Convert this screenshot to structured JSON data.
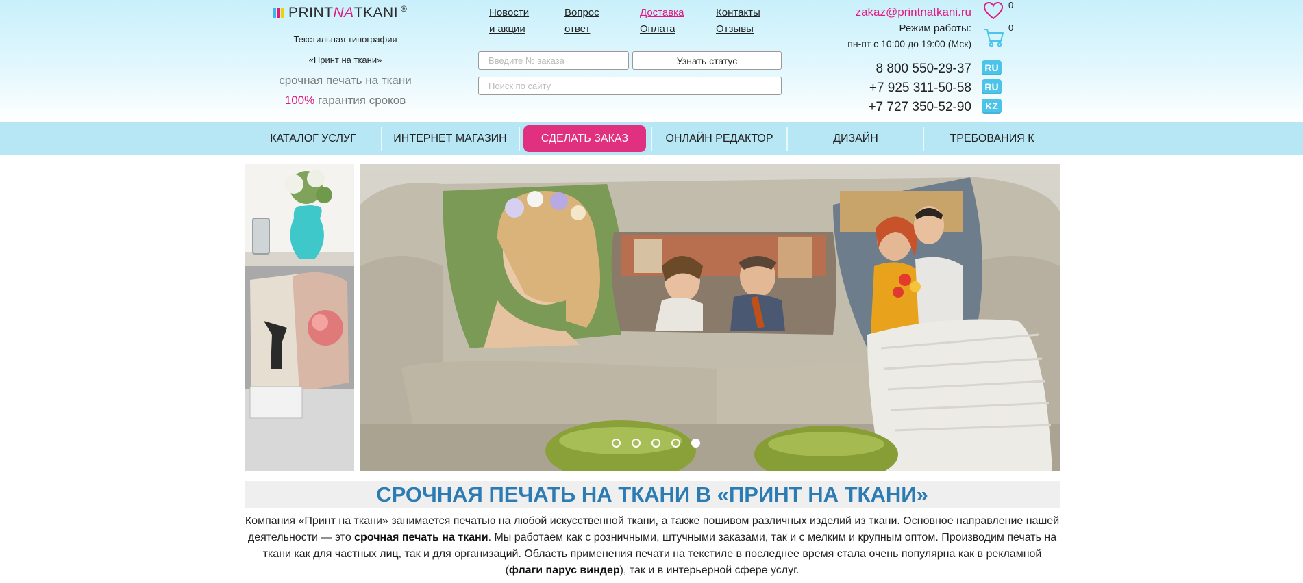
{
  "brand": {
    "logo_part1": "PRINT",
    "logo_part2": "NA",
    "logo_part3": "TKANI",
    "registered": "®",
    "tagline_1": "Текстильная типография",
    "tagline_2": "«Принт на ткани»",
    "tagline_3": "срочная печать на ткани",
    "tagline_4_highlight": "100%",
    "tagline_4_rest": " гарантия сроков",
    "colors": {
      "pink": "#e2197f",
      "cyan": "#4cc4ea",
      "yellow": "#f4d000",
      "dark": "#2b2b2b"
    }
  },
  "top_links": {
    "news_line1": "Новости",
    "news_line2": "и акции",
    "faq_line1": "Вопрос",
    "faq_line2": "ответ",
    "delivery": "Доставка",
    "payment": "Оплата",
    "contacts": "Контакты",
    "reviews": "Отзывы"
  },
  "order_check": {
    "placeholder": "Введите № заказа",
    "button_label": "Узнать статус"
  },
  "search": {
    "placeholder": "Поиск по сайту"
  },
  "contact": {
    "email": "zakaz@printnatkani.ru",
    "hours_label": "Режим работы:",
    "hours": "пн-пт с 10:00 до 19:00 (Мск)",
    "wishlist_count": "0",
    "cart_count": "0",
    "phones": [
      {
        "number": "8 800 550-29-37",
        "country": "RU"
      },
      {
        "number": "+7 925 311-50-58",
        "country": "RU"
      },
      {
        "number": "+7 727 350-52-90",
        "country": "KZ"
      }
    ]
  },
  "main_nav": {
    "catalog": "КАТАЛОГ УСЛУГ",
    "shop": "ИНТЕРНЕТ МАГАЗИН",
    "order": "СДЕЛАТЬ ЗАКАЗ",
    "editor": "ОНЛАЙН РЕДАКТОР",
    "design": "ДИЗАЙН",
    "requirements": "ТРЕБОВАНИЯ К МАКЕТАМ",
    "cta_color": "#e0307f",
    "bar_color": "#b7e6f4"
  },
  "slider": {
    "total_slides": 5,
    "active_slide": 5
  },
  "content": {
    "title": "СРОЧНАЯ ПЕЧАТЬ НА ТКАНИ В «ПРИНТ НА ТКАНИ»",
    "intro_1": "Компания «Принт на ткани» занимается печатью на любой искусственной ткани, а также пошивом различных изделий из ткани. Основное направление нашей деятельности — это ",
    "intro_bold_1": "срочная печать на ткани",
    "intro_2": ". Мы работаем как с розничными, штучными заказами, так и с мелким и крупным оптом. Производим печать на ткани как для частных лиц, так и для организаций. Область применения печати на текстиле в последнее время стала очень популярна как в рекламной (",
    "intro_link": "флаги парус виндер",
    "intro_3": "), так и в интерьерной сфере услуг."
  }
}
